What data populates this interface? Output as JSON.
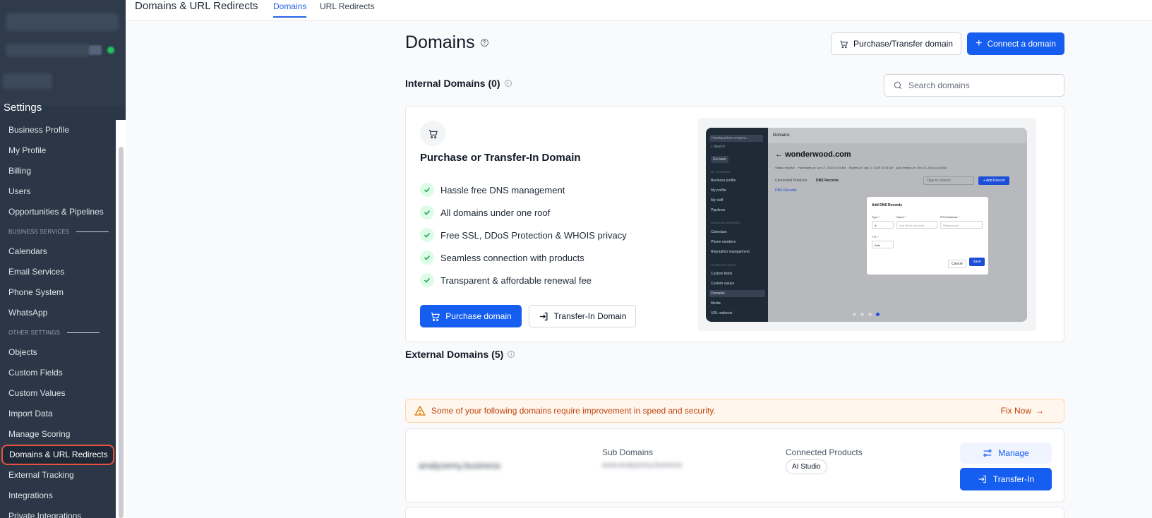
{
  "sidebar": {
    "title": "Settings",
    "items": [
      {
        "label": "Business Profile"
      },
      {
        "label": "My Profile"
      },
      {
        "label": "Billing"
      },
      {
        "label": "Users"
      },
      {
        "label": "Opportunities & Pipelines"
      }
    ],
    "section_business": "BUSINESS SERVICES",
    "business_items": [
      {
        "label": "Calendars"
      },
      {
        "label": "Email Services"
      },
      {
        "label": "Phone System"
      },
      {
        "label": "WhatsApp"
      }
    ],
    "section_other": "OTHER SETTINGS",
    "other_items": [
      {
        "label": "Objects"
      },
      {
        "label": "Custom Fields"
      },
      {
        "label": "Custom Values"
      },
      {
        "label": "Import Data"
      },
      {
        "label": "Manage Scoring"
      },
      {
        "label": "Domains & URL Redirects",
        "active": true
      },
      {
        "label": "External Tracking"
      },
      {
        "label": "Integrations"
      },
      {
        "label": "Private Integrations"
      }
    ]
  },
  "topbar": {
    "title": "Domains & URL Redirects",
    "tabs": [
      {
        "label": "Domains",
        "active": true
      },
      {
        "label": "URL Redirects",
        "active": false
      }
    ]
  },
  "page": {
    "title": "Domains",
    "purchase_transfer_label": "Purchase/Transfer domain",
    "connect_label": "Connect a domain",
    "internal_heading": "Internal Domains (0)",
    "search_placeholder": "Search domains",
    "promo": {
      "title": "Purchase or Transfer-In Domain",
      "features": [
        "Hassle free DNS management",
        "All domains under one roof",
        "Free SSL, DDoS Protection & WHOIS privacy",
        "Seamless connection with products",
        "Transparent & affordable renewal fee"
      ],
      "purchase_label": "Purchase domain",
      "transfer_label": "Transfer-In Domain"
    },
    "preview": {
      "header": "Domains",
      "domain": "wonderwood.com",
      "go_back": "Go back",
      "tab": "Connected Products",
      "dns_tab": "DNS Records",
      "dns_title": "DNS Records",
      "search_placeholder": "Type to Search",
      "add_record": "+ Add Record",
      "modal_title": "Add DNS Records",
      "type_label": "Type *",
      "name_label": "Name *",
      "ip_label": "IPV4 Address *",
      "ttl_label": "TTL *",
      "type_value": "A",
      "name_placeholder": "Use @ for root dom...",
      "ip_placeholder": "Please input",
      "ttl_value": "Auto",
      "cancel": "Cancel",
      "save": "Save",
      "side_items": [
        "Business profile",
        "My profile",
        "My staff",
        "Pipelines",
        "Calendars",
        "Phone numbers",
        "Reputation management",
        "Custom fields",
        "Custom values",
        "Domains",
        "Media",
        "URL redirects"
      ],
      "side_sections": [
        "MY BUSINESS",
        "BUSINESS SERVICES",
        "OTHER SETTINGS"
      ],
      "dots": [
        false,
        false,
        false,
        true
      ]
    },
    "external_heading": "External Domains (5)",
    "alert": {
      "message": "Some of your following domains require improvement in speed and security.",
      "action": "Fix Now"
    },
    "domain_row": {
      "domain": "analyzemy.business",
      "sub_domains_label": "Sub Domains",
      "sub_domains_value": "www.analyzemy.business",
      "connected_label": "Connected Products",
      "connected_chip": "AI Studio",
      "manage_label": "Manage",
      "transfer_label": "Transfer-In"
    }
  },
  "colors": {
    "sidebar_bg": "#2b3746",
    "primary": "#155eef",
    "active_outline": "#e5533d",
    "warning": "#c2410c"
  }
}
